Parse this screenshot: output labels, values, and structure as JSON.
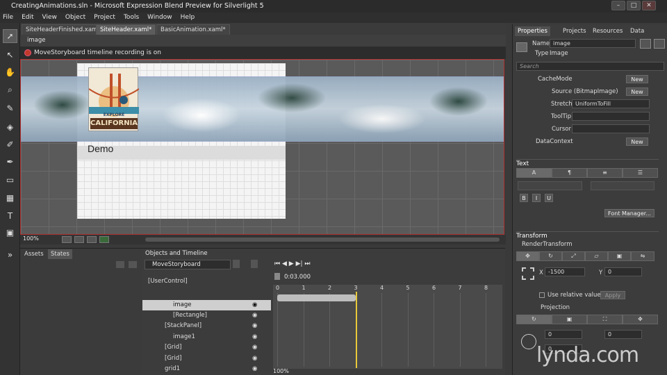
{
  "window": {
    "title": "CreatingAnimations.sln - Microsoft Expression Blend Preview for Silverlight 5",
    "controls": [
      "–",
      "□",
      "✕"
    ]
  },
  "menu": [
    "File",
    "Edit",
    "View",
    "Object",
    "Project",
    "Tools",
    "Window",
    "Help"
  ],
  "doc_tabs": [
    {
      "label": "SiteHeaderFinished.xaml",
      "active": false
    },
    {
      "label": "SiteHeader.xaml*",
      "active": true
    },
    {
      "label": "BasicAnimation.xaml*",
      "active": false
    }
  ],
  "breadcrumb": "image",
  "recording": "MoveStoryboard timeline recording is on",
  "artboard": {
    "logo_text_1": "EXPLORE",
    "logo_text_2": "CALIFORNIA",
    "demo_text": "Demo",
    "zoom": "100%"
  },
  "properties_panel": {
    "tabs": [
      "Properties",
      "Projects",
      "Resources",
      "Data"
    ],
    "name_label": "Name",
    "name_value": "image",
    "type_label": "Type",
    "type_value": "Image",
    "search_placeholder": "Search",
    "rows": [
      {
        "label": "CacheMode",
        "button": "New"
      },
      {
        "label": "Source (BitmapImage)",
        "button": "New"
      },
      {
        "label": "Stretch",
        "value": "UniformToFill"
      },
      {
        "label": "ToolTip",
        "value": ""
      },
      {
        "label": "Cursor",
        "value": ""
      },
      {
        "label": "DataContext",
        "button": "New"
      }
    ],
    "text_section": "Text",
    "text_buttons": [
      "B",
      "I",
      "U"
    ],
    "font_manager": "Font Manager...",
    "transform_section": "Transform",
    "render_transform": "RenderTransform",
    "x_label": "X",
    "x_value": "-1500",
    "y_label": "Y",
    "y_value": "0",
    "use_relative": "Use relative values",
    "apply": "Apply",
    "projection_label": "Projection",
    "proj_x": "0",
    "proj_y": "0",
    "proj_z": "0"
  },
  "bottom_left": {
    "tabs": [
      "Assets",
      "States"
    ]
  },
  "objects_timeline": {
    "title": "Objects and Timeline",
    "storyboard": "MoveStoryboard",
    "time": "0:03.000",
    "ticks": [
      "0",
      "1",
      "2",
      "3",
      "4",
      "5",
      "6",
      "7",
      "8"
    ],
    "tree": [
      {
        "label": "[UserControl]",
        "indent": 0,
        "selected": false
      },
      {
        "label": "image",
        "indent": 3,
        "selected": true
      },
      {
        "label": "[Rectangle]",
        "indent": 3,
        "selected": false
      },
      {
        "label": "[StackPanel]",
        "indent": 2,
        "selected": false
      },
      {
        "label": "image1",
        "indent": 3,
        "selected": false
      },
      {
        "label": "[Grid]",
        "indent": 2,
        "selected": false
      },
      {
        "label": "[Grid]",
        "indent": 2,
        "selected": false
      },
      {
        "label": "grid1",
        "indent": 2,
        "selected": false
      }
    ],
    "zoom": "100%",
    "keyframe_end": 3
  },
  "watermark": "lynda.com"
}
